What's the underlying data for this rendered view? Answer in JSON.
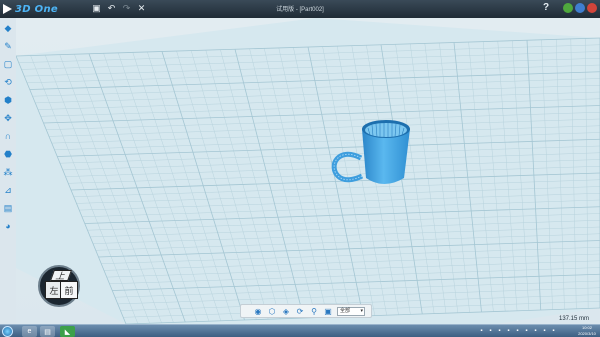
{
  "app": {
    "logo_text": "3D One",
    "window_title": "试用版 - [Part002]"
  },
  "titlebar": {
    "quick_access": [
      {
        "name": "save-icon",
        "glyph": "💾"
      },
      {
        "name": "undo-icon",
        "glyph": "↶"
      },
      {
        "name": "redo-icon",
        "glyph": "↷"
      },
      {
        "name": "close-doc-icon",
        "glyph": "✕"
      }
    ],
    "help_label": "?",
    "window_buttons": [
      "minimize",
      "maximize",
      "close"
    ]
  },
  "left_toolbar": [
    {
      "name": "basic-solid-icon",
      "glyph": "◆"
    },
    {
      "name": "sketch-icon",
      "glyph": "✎"
    },
    {
      "name": "sketch-edit-icon",
      "glyph": "▢"
    },
    {
      "name": "feature-icon",
      "glyph": "⟲"
    },
    {
      "name": "combine-icon",
      "glyph": "⬢"
    },
    {
      "name": "transform-icon",
      "glyph": "✥"
    },
    {
      "name": "magnet-icon",
      "glyph": "∩"
    },
    {
      "name": "material-icon",
      "glyph": "⬣"
    },
    {
      "name": "distribute-icon",
      "glyph": "⁂"
    },
    {
      "name": "measure-icon",
      "glyph": "⊿"
    },
    {
      "name": "library-icon",
      "glyph": "▤"
    },
    {
      "name": "color-icon",
      "glyph": "◕"
    }
  ],
  "view_cube": {
    "top_label": "上",
    "left_label": "左",
    "front_label": "前"
  },
  "view_toolbar": {
    "icons": [
      {
        "name": "view-eye-icon",
        "glyph": "👁"
      },
      {
        "name": "view-cube-icon",
        "glyph": "⬡"
      },
      {
        "name": "view-shade-icon",
        "glyph": "◈"
      },
      {
        "name": "view-rotate-icon",
        "glyph": "⟳"
      },
      {
        "name": "view-zoom-icon",
        "glyph": "🔍"
      },
      {
        "name": "view-fit-icon",
        "glyph": "▣"
      }
    ],
    "select_value": "全部"
  },
  "measurement": "137.15 mm",
  "taskbar": {
    "apps": [
      {
        "name": "taskbar-ie-icon",
        "glyph": "e"
      },
      {
        "name": "taskbar-explorer-icon",
        "glyph": "▤"
      },
      {
        "name": "taskbar-3done-icon",
        "glyph": "◣"
      }
    ],
    "tray_count": 9,
    "clock_time": "10:02",
    "clock_date": "2020/3/10"
  },
  "colors": {
    "accent": "#2e7fd0",
    "model": "#45a8e6",
    "grid": "#b9d4de"
  }
}
